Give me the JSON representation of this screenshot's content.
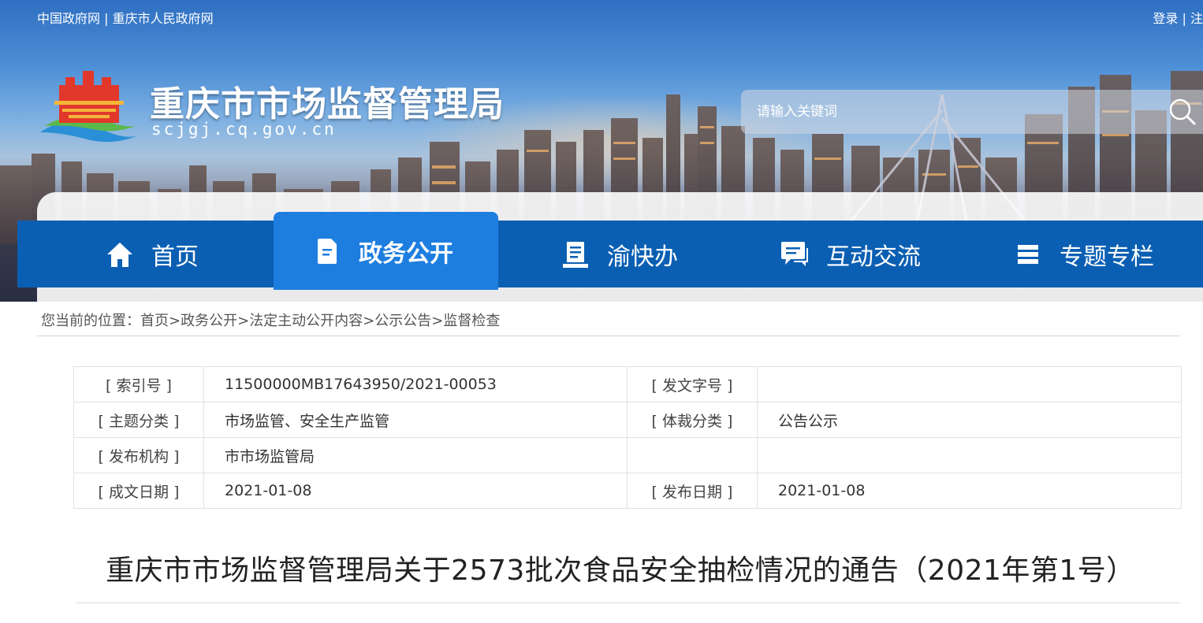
{
  "header": {
    "top_links": [
      "中国政府网",
      "重庆市人民政府网"
    ],
    "top_sep": "|",
    "top_right": "登录 | 注",
    "site_title": "重庆市市场监督管理局",
    "site_domain": "scjgj.cq.gov.cn",
    "search_placeholder": "请输入关键词",
    "search_icon": "search-icon"
  },
  "nav": {
    "items": [
      {
        "label": "首页",
        "icon": "home-icon"
      },
      {
        "label": "政务公开",
        "icon": "document-icon",
        "active": true
      },
      {
        "label": "渝快办",
        "icon": "service-icon"
      },
      {
        "label": "互动交流",
        "icon": "chat-icon"
      },
      {
        "label": "专题专栏",
        "icon": "stack-icon"
      }
    ]
  },
  "breadcrumb": {
    "prefix": "您当前的位置：",
    "items": [
      "首页",
      "政务公开",
      "法定主动公开内容",
      "公示公告",
      "监督检查"
    ],
    "sep": ">"
  },
  "info": {
    "rows": [
      {
        "k1": "[ 索引号 ]",
        "v1": "11500000MB17643950/2021-00053",
        "k2": "[ 发文字号 ]",
        "v2": ""
      },
      {
        "k1": "[ 主题分类 ]",
        "v1": "市场监管、安全生产监管",
        "k2": "[ 体裁分类 ]",
        "v2": "公告公示"
      },
      {
        "k1": "[ 发布机构 ]",
        "v1": "市市场监管局",
        "k2": "",
        "v2": ""
      },
      {
        "k1": "[ 成文日期 ]",
        "v1": "2021-01-08",
        "k2": "[ 发布日期 ]",
        "v2": "2021-01-08"
      }
    ]
  },
  "article": {
    "title": "重庆市市场监督管理局关于2573批次食品安全抽检情况的通告（2021年第1号）"
  },
  "colors": {
    "nav_bg": "#0b5fb3",
    "nav_active": "#1e7ee0"
  }
}
